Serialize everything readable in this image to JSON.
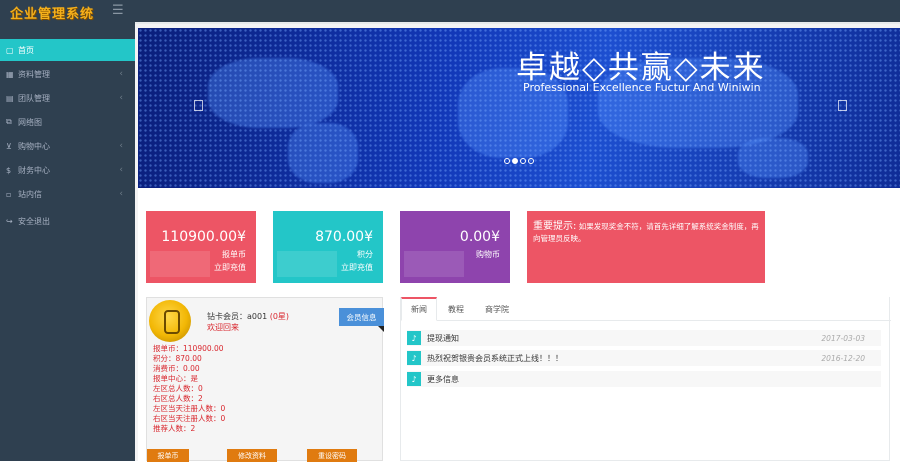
{
  "app": {
    "title": "企业管理系统"
  },
  "sidebar": {
    "items": [
      {
        "label": "首页",
        "icon": "square-icon"
      },
      {
        "label": "资料管理",
        "icon": "grid-icon"
      },
      {
        "label": "团队管理",
        "icon": "users-icon"
      },
      {
        "label": "网络图",
        "icon": "sitemap-icon"
      },
      {
        "label": "购物中心",
        "icon": "cart-icon"
      },
      {
        "label": "财务中心",
        "icon": "dollar-icon"
      },
      {
        "label": "站内信",
        "icon": "mail-icon"
      },
      {
        "label": "安全退出",
        "icon": "logout-icon"
      }
    ]
  },
  "banner": {
    "title": "卓越◇共赢◇未来",
    "subtitle": "Professional Excellence Fuctur And Winiwin"
  },
  "cards": [
    {
      "value": "110900.00¥",
      "line1": "报单币",
      "line2": "立即充值",
      "color": "#ed5565"
    },
    {
      "value": "870.00¥",
      "line1": "积分",
      "line2": "立即充值",
      "color": "#23c6c8"
    },
    {
      "value": "0.00¥",
      "line1": "购物币",
      "line2": "",
      "color": "#8e44ad"
    }
  ],
  "notice": {
    "lead": "重要提示:",
    "text": "如果发现奖金不符，请首先详细了解系统奖金制度，再向管理员反映。"
  },
  "profile": {
    "member_label": "钻卡会员：a001",
    "rank": "(0星)",
    "welcome": "欢迎回来",
    "info_button": "会员信息",
    "stats": [
      "报单币：110900.00",
      "积分：870.00",
      "消费币：0.00",
      "报单中心：是",
      "左区总人数：0",
      "右区总人数：2",
      "左区当天注册人数：0",
      "右区当天注册人数：0",
      "推荐人数：2"
    ],
    "actions": [
      "报单币",
      "修改资料",
      "重设密码"
    ]
  },
  "news": {
    "tabs": [
      "新闻",
      "教程",
      "商学院"
    ],
    "rows": [
      {
        "title": "提现通知",
        "date": "2017-03-03"
      },
      {
        "title": "热烈祝贺银贵会员系统正式上线！！！",
        "date": "2016-12-20"
      },
      {
        "title": "更多信息",
        "date": ""
      }
    ]
  }
}
